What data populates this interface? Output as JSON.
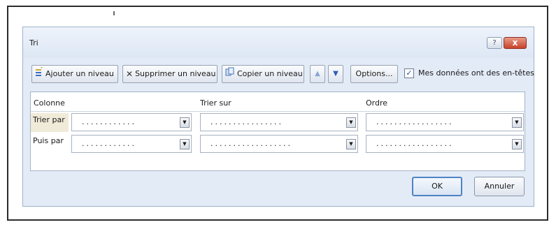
{
  "dialog": {
    "title": "Tri",
    "help_icon": "?",
    "close_icon": "x"
  },
  "toolbar": {
    "add_level_icon": "add-level-icon",
    "add_level_label": "Ajouter un niveau",
    "delete_level_icon": "x-icon",
    "delete_level_label": "Supprimer un niveau",
    "copy_level_icon": "copy-icon",
    "copy_level_label": "Copier un niveau",
    "move_up_icon": "▲",
    "move_down_icon": "▼",
    "options_label": "Options...",
    "has_headers_label": "Mes données ont des en-têtes",
    "has_headers_checked": true
  },
  "grid": {
    "columns": {
      "column": "Colonne",
      "sort_on": "Trier sur",
      "order": "Ordre"
    },
    "rows": [
      {
        "label": "Trier par",
        "column_value": "............",
        "sort_on_value": "................",
        "order_value": "................."
      },
      {
        "label": "Puis par",
        "column_value": "............",
        "sort_on_value": "..................",
        "order_value": "................."
      }
    ]
  },
  "footer": {
    "ok_label": "OK",
    "cancel_label": "Annuler"
  },
  "colors": {
    "dialog_bg": "#e3ebf6",
    "close_button": "#c8432c",
    "ok_border": "#4f83c4"
  }
}
